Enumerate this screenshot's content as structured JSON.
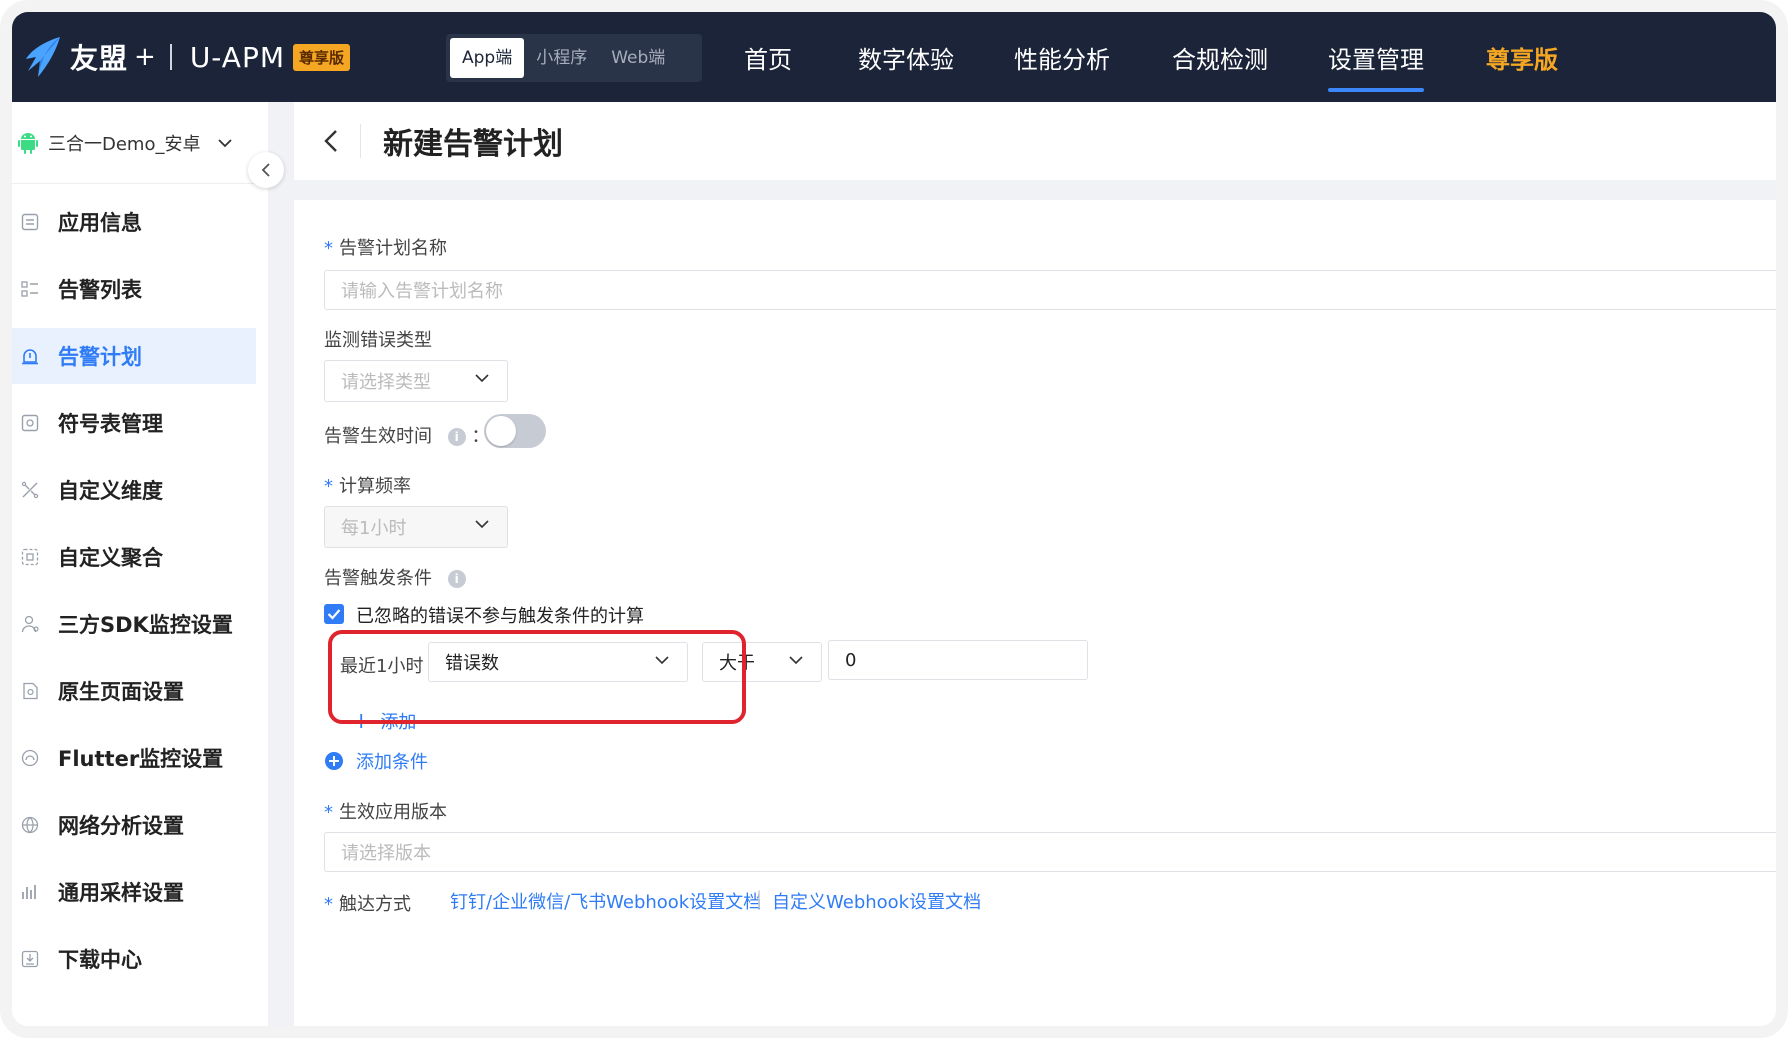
{
  "topbar": {
    "brand": "友盟",
    "plus": "+",
    "product": "U-APM",
    "edition_badge": "尊享版",
    "platforms": [
      {
        "label": "App端",
        "active": true
      },
      {
        "label": "小程序",
        "active": false
      },
      {
        "label": "Web端",
        "active": false
      }
    ],
    "nav": [
      {
        "label": "首页"
      },
      {
        "label": "数字体验"
      },
      {
        "label": "性能分析"
      },
      {
        "label": "合规检测"
      },
      {
        "label": "设置管理",
        "active": true
      },
      {
        "label": "尊享版"
      }
    ]
  },
  "sidebar": {
    "app_selector": "三合一Demo_安卓",
    "items": [
      {
        "label": "应用信息",
        "icon": "document-icon"
      },
      {
        "label": "告警列表",
        "icon": "list-icon"
      },
      {
        "label": "告警计划",
        "icon": "alarm-icon",
        "active": true
      },
      {
        "label": "符号表管理",
        "icon": "symbol-icon"
      },
      {
        "label": "自定义维度",
        "icon": "dimension-icon"
      },
      {
        "label": "自定义聚合",
        "icon": "aggregate-icon"
      },
      {
        "label": "三方SDK监控设置",
        "icon": "user-sdk-icon"
      },
      {
        "label": "原生页面设置",
        "icon": "page-settings-icon"
      },
      {
        "label": "Flutter监控设置",
        "icon": "flutter-icon"
      },
      {
        "label": "网络分析设置",
        "icon": "network-icon"
      },
      {
        "label": "通用采样设置",
        "icon": "sampling-icon"
      },
      {
        "label": "下载中心",
        "icon": "download-icon"
      }
    ]
  },
  "page": {
    "title": "新建告警计划"
  },
  "form": {
    "plan_name_label": "告警计划名称",
    "plan_name_placeholder": "请输入告警计划名称",
    "error_type_label": "监测错误类型",
    "error_type_placeholder": "请选择类型",
    "effective_time_label": "告警生效时间",
    "effective_time_colon": "：",
    "effective_time_enabled": false,
    "frequency_label": "计算频率",
    "frequency_value": "每1小时",
    "trigger_label": "告警触发条件",
    "ignore_checkbox_label": "已忽略的错误不参与触发条件的计算",
    "ignore_checked": true,
    "condition": {
      "window": "最近1小时",
      "metric": "错误数",
      "operator": "大于",
      "threshold": "0"
    },
    "add_label": "添加",
    "add_condition_label": "添加条件",
    "version_label": "生效应用版本",
    "version_placeholder": "请选择版本",
    "delivery_label": "触达方式",
    "delivery_link1": "钉钉/企业微信/飞书Webhook设置文档",
    "delivery_sep": "|",
    "delivery_link2": "自定义Webhook设置文档"
  },
  "colors": {
    "topbar_bg": "#1b2438",
    "accent": "#2f7cf6",
    "vip": "#f5a623",
    "highlight": "#e0242d"
  }
}
